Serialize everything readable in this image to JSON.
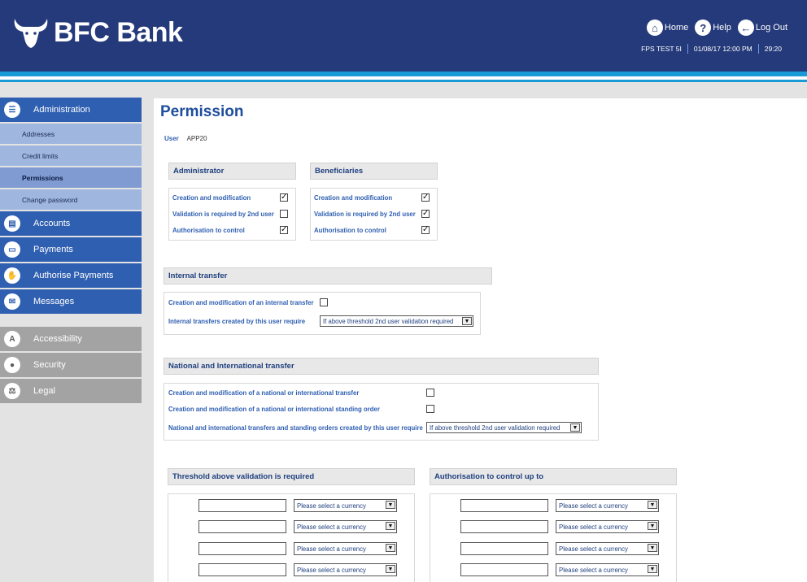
{
  "brand": {
    "name": "BFC Bank"
  },
  "topnav": {
    "home": "Home",
    "help": "Help",
    "logout": "Log Out"
  },
  "status": {
    "system": "FPS TEST 5I",
    "datetime": "01/08/17 12:00 PM",
    "timer": "29:20"
  },
  "sidebar": {
    "administration": "Administration",
    "subitems": [
      "Addresses",
      "Credit limits",
      "Permissions",
      "Change password"
    ],
    "accounts": "Accounts",
    "payments": "Payments",
    "authorise": "Authorise Payments",
    "messages": "Messages",
    "accessibility": "Accessibility",
    "security": "Security",
    "legal": "Legal"
  },
  "page": {
    "title": "Permission",
    "user_label": "User",
    "user_value": "APP20"
  },
  "administrator": {
    "heading": "Administrator",
    "rows": [
      "Creation and modification",
      "Validation is required by 2nd user",
      "Authorisation to control"
    ],
    "checked": [
      true,
      false,
      true
    ]
  },
  "beneficiaries": {
    "heading": "Beneficiaries",
    "rows": [
      "Creation and modification",
      "Validation is required by 2nd user",
      "Authorisation to control"
    ],
    "checked": [
      true,
      true,
      true
    ]
  },
  "internal": {
    "heading": "Internal transfer",
    "row1": "Creation and modification of an internal transfer",
    "row1_checked": false,
    "row2": "Internal transfers created by this user require",
    "row2_value": "If above threshold 2nd user validation required"
  },
  "national": {
    "heading": "National and International transfer",
    "row1": "Creation and modification of a national or international transfer",
    "row1_checked": false,
    "row2": "Creation and modification of a national or international standing order",
    "row2_checked": false,
    "row3": "National and international transfers and standing orders created by this user require",
    "row3_value": "If above threshold 2nd user validation required"
  },
  "threshold": {
    "heading": "Threshold above validation is required",
    "currency_placeholder": "Please select a currency"
  },
  "authorisation": {
    "heading": "Authorisation to control up to",
    "currency_placeholder": "Please select a currency"
  },
  "colors": {
    "header": "#253a7a",
    "accent": "#1a9bd7",
    "menu_blue": "#2f5fb1",
    "menu_gray": "#a3a3a3"
  }
}
